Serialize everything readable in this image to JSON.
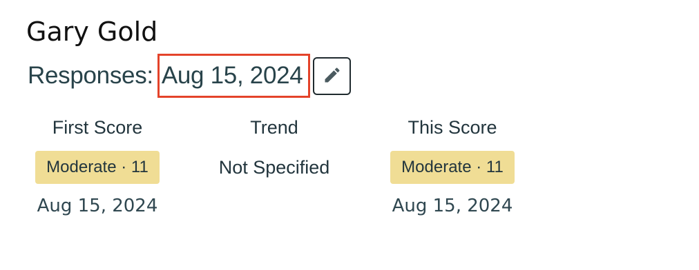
{
  "patient": {
    "name": "Gary Gold"
  },
  "responses": {
    "label": "Responses:",
    "date": "Aug 15, 2024",
    "edit_icon": "pencil-icon"
  },
  "scores": {
    "first": {
      "header": "First Score",
      "badge": "Moderate · 11",
      "date": "Aug 15, 2024"
    },
    "trend": {
      "header": "Trend",
      "value": "Not Specified"
    },
    "current": {
      "header": "This Score",
      "badge": "Moderate · 11",
      "date": "Aug 15, 2024"
    }
  },
  "colors": {
    "badge_background": "#f0dd95",
    "highlight_border": "#e4432a",
    "text_primary": "#22353d"
  }
}
